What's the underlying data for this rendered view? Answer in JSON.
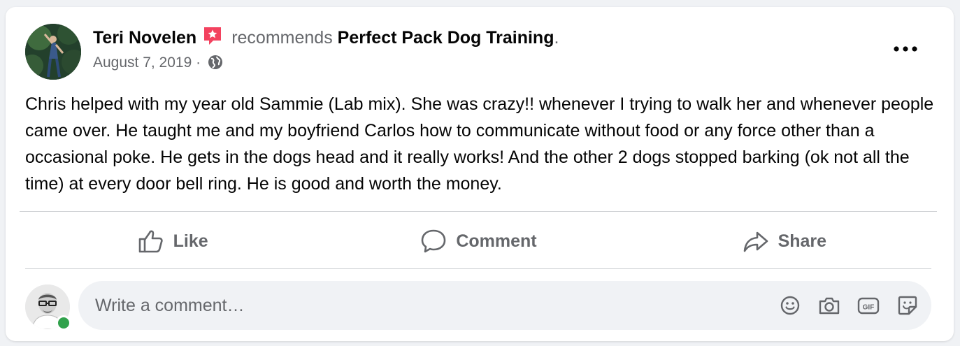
{
  "post": {
    "author": "Teri Novelen",
    "recommends_text": "recommends",
    "page_name": "Perfect Pack Dog Training",
    "page_name_suffix": ".",
    "date": "August 7, 2019",
    "meta_separator": " · ",
    "body": "Chris helped with my year old Sammie (Lab mix). She was crazy!! whenever I trying to walk her and whenever people came over. He taught me and my boyfriend Carlos how to communicate without food or any force other than a occasional poke. He gets in the dogs head and it really works! And the other 2 dogs stopped barking (ok not all the time) at every door bell ring. He is good and worth the money.",
    "more_icon": "more-horizontal-icon",
    "audience_icon": "globe-icon",
    "recommend_icon": "recommend-star-icon"
  },
  "actions": {
    "like_label": "Like",
    "comment_label": "Comment",
    "share_label": "Share"
  },
  "composer": {
    "placeholder": "Write a comment…",
    "tools": [
      "emoji-icon",
      "camera-icon",
      "gif-icon",
      "sticker-icon"
    ]
  },
  "colors": {
    "secondary_text": "#65676b",
    "primary_text": "#050505",
    "recommend_badge": "#f3425f",
    "online": "#31a24c",
    "card_bg": "#ffffff",
    "page_bg": "#f0f2f5"
  }
}
